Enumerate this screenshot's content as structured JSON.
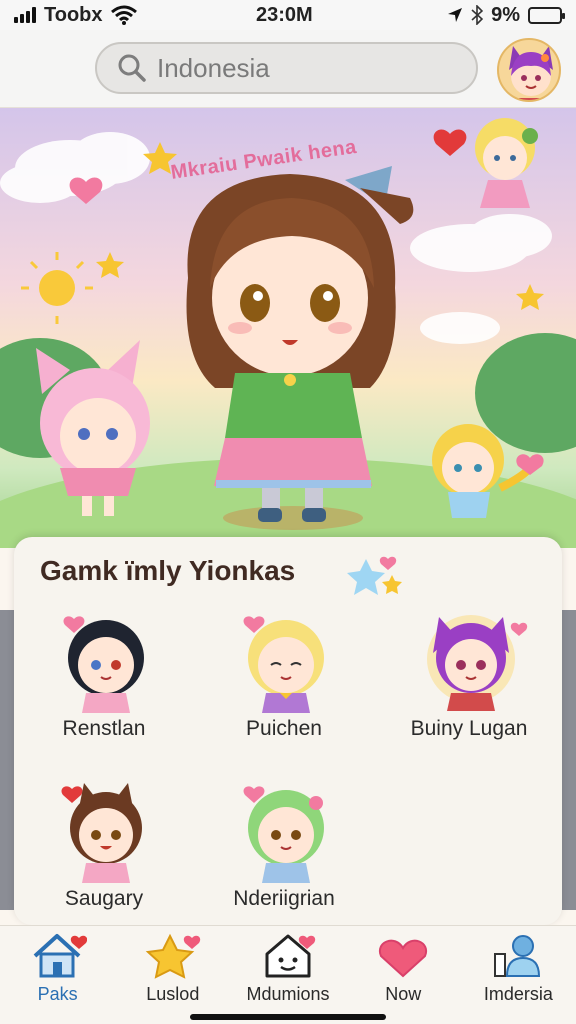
{
  "status_bar": {
    "carrier": "Toobx",
    "time": "23:0M",
    "battery": "9%",
    "icons": [
      "signal-icon",
      "wifi-icon",
      "location-arrow-icon",
      "bluetooth-icon",
      "battery-icon"
    ]
  },
  "search": {
    "placeholder": "Indonesia"
  },
  "hero": {
    "title": "Mkraiu Pwaik hena"
  },
  "panel": {
    "title": "Gamk ïmly Yionkas",
    "friends": [
      {
        "name": "Renstlan"
      },
      {
        "name": "Puichen"
      },
      {
        "name": "Buiny Lugan"
      },
      {
        "name": "Saugary"
      },
      {
        "name": "Nderiigrian"
      }
    ]
  },
  "nav": {
    "items": [
      {
        "label": "Paks",
        "icon": "home-icon"
      },
      {
        "label": "Luslod",
        "icon": "star-icon"
      },
      {
        "label": "Mdumions",
        "icon": "house-face-icon"
      },
      {
        "label": "Now",
        "icon": "heart-icon"
      },
      {
        "label": "Imdersia",
        "icon": "person-icon"
      }
    ],
    "active": "Paks"
  },
  "colors": {
    "accent": "#2b70b3",
    "heart": "#ef5a7a",
    "star": "#f7c531"
  }
}
